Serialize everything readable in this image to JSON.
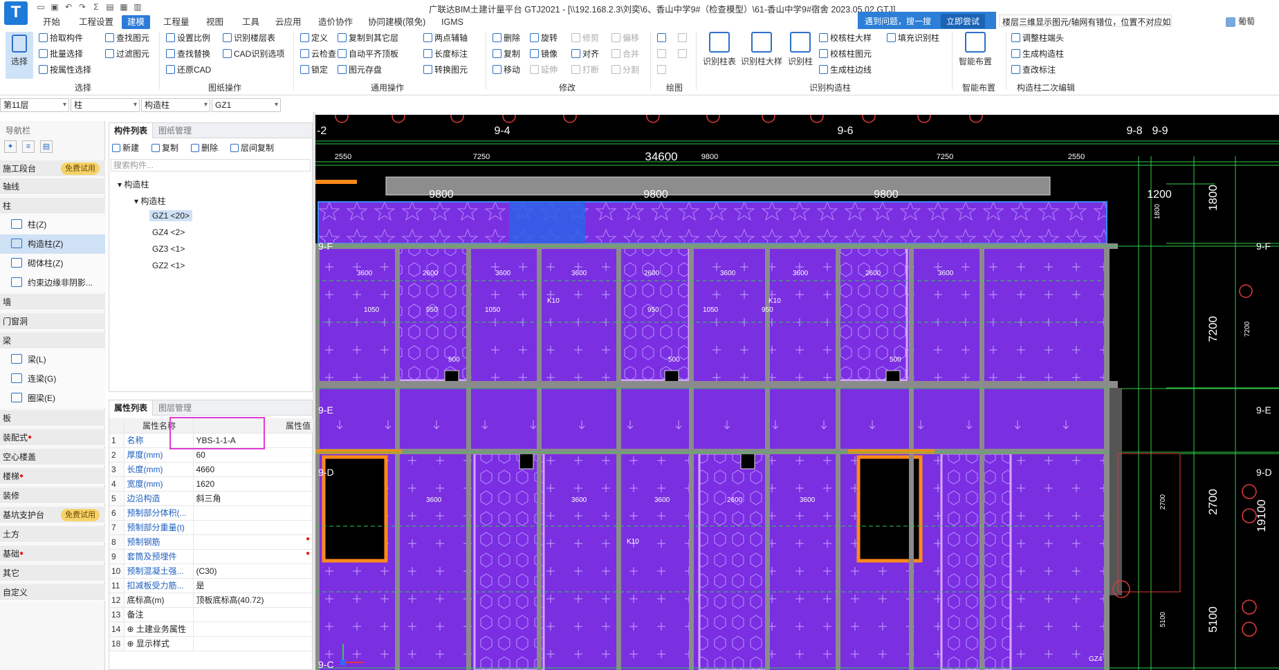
{
  "title_bar": {
    "window_title": "广联达BIM土建计量平台 GTJ2021 - [\\\\192.168.2.3\\刘奕\\6、香山中学9#（检查模型）\\61-香山中学9#宿舍  2023.05.02.GTJ]"
  },
  "menu": {
    "tabs": [
      "开始",
      "工程设置",
      "建模",
      "工程量",
      "视图",
      "工具",
      "云应用",
      "造价协作",
      "协同建模(限免)",
      "IGMS"
    ],
    "active": "建模"
  },
  "help": {
    "popup_text": "遇到问题，搜一搜",
    "popup_button": "立即尝试",
    "search_text": "楼层三维显示图元/轴网有错位，位置不对应如何处理？",
    "user_name": "葡萄"
  },
  "ribbon": {
    "select_label": "选择",
    "select_group": {
      "items": [
        "拾取构件",
        "批量选择",
        "按属性选择",
        "查找图元",
        "过滤图元"
      ],
      "label": "选择"
    },
    "drawing_group": {
      "items": [
        "设置比例",
        "查找替换",
        "还原CAD",
        "识别楼层表",
        "CAD识别选项"
      ],
      "label": "图纸操作"
    },
    "common_group": {
      "items": [
        "定义",
        "云检查",
        "锁定",
        "复制到其它层",
        "自动平齐顶板",
        "图元存盘",
        "两点辅轴",
        "长度标注",
        "转换图元"
      ],
      "label": "通用操作"
    },
    "modify_group": {
      "items": [
        "删除",
        "复制",
        "移动",
        "旋转",
        "镜像",
        "延伸",
        "修剪",
        "对齐",
        "打断",
        "偏移",
        "合并",
        "分割"
      ],
      "label": "修改"
    },
    "draw_group": {
      "label": "绘图"
    },
    "recog_group": {
      "big": [
        "识别柱表",
        "识别柱大样",
        "识别柱"
      ],
      "items": [
        "校核柱大样",
        "校核柱图元",
        "生成柱边线",
        "填充识别柱"
      ],
      "label": "识别构造柱"
    },
    "smart_group": {
      "big": "智能布置",
      "label": "智能布置"
    },
    "edit2_group": {
      "items": [
        "调整柱端头",
        "生成构造柱",
        "查改标注"
      ],
      "label": "构造柱二次编辑"
    }
  },
  "selectors": {
    "floor": "第11层",
    "type": "柱",
    "subtype": "构造柱",
    "name": "GZ1"
  },
  "nav": {
    "title": "导航栏",
    "free_trial": "免费试用",
    "categories": [
      {
        "label": "施工段台",
        "badge": true
      },
      {
        "label": "轴线"
      },
      {
        "label": "柱"
      },
      {
        "label": "墙"
      },
      {
        "label": "门窗洞"
      },
      {
        "label": "梁"
      },
      {
        "label": "板"
      },
      {
        "label": "装配式",
        "dot": true
      },
      {
        "label": "空心楼盖"
      },
      {
        "label": "楼梯",
        "dot": true
      },
      {
        "label": "装修"
      },
      {
        "label": "基坑支护台",
        "badge": true
      },
      {
        "label": "土方"
      },
      {
        "label": "基础",
        "dot": true
      },
      {
        "label": "其它"
      },
      {
        "label": "自定义"
      }
    ],
    "column_items": [
      "柱(Z)",
      "构造柱(Z)",
      "砌体柱(Z)",
      "约束边缘非阴影..."
    ],
    "beam_items": [
      "梁(L)",
      "连梁(G)",
      "圈梁(E)"
    ]
  },
  "component_list": {
    "tabs": [
      "构件列表",
      "图纸管理"
    ],
    "tools": [
      "新建",
      "复制",
      "删除",
      "层间复制"
    ],
    "search_placeholder": "搜索构件...",
    "tree_root": "构造柱",
    "tree_child": "构造柱",
    "items": [
      "GZ1 <20>",
      "GZ4 <2>",
      "GZ3 <1>",
      "GZ2 <1>"
    ]
  },
  "properties": {
    "tabs": [
      "属性列表",
      "图层管理"
    ],
    "header_name": "属性名称",
    "header_value": "属性值",
    "rows": [
      {
        "no": "1",
        "name": "名称",
        "value": "YBS-1-1-A"
      },
      {
        "no": "2",
        "name": "厚度(mm)",
        "value": "60"
      },
      {
        "no": "3",
        "name": "长度(mm)",
        "value": "4660"
      },
      {
        "no": "4",
        "name": "宽度(mm)",
        "value": "1620"
      },
      {
        "no": "5",
        "name": "边沿构造",
        "value": "斜三角"
      },
      {
        "no": "6",
        "name": "预制部分体积(...",
        "value": ""
      },
      {
        "no": "7",
        "name": "预制部分重量(t)",
        "value": ""
      },
      {
        "no": "8",
        "name": "预制钢筋",
        "value": "",
        "dot": true
      },
      {
        "no": "9",
        "name": "套筒及预埋件",
        "value": "",
        "dot": true
      },
      {
        "no": "10",
        "name": "预制混凝土强...",
        "value": "(C30)"
      },
      {
        "no": "11",
        "name": "扣减板受力筋...",
        "value": "是"
      },
      {
        "no": "12",
        "name": "底标高(m)",
        "value": "顶板底标高(40.72)",
        "plain": true
      },
      {
        "no": "13",
        "name": "备注",
        "value": "",
        "plain": true
      },
      {
        "no": "14",
        "name": "⊕ 土建业务属性",
        "value": "",
        "plain": true
      },
      {
        "no": "18",
        "name": "⊕ 显示样式",
        "value": "",
        "plain": true
      }
    ]
  },
  "canvas": {
    "grid_labels": {
      "a": "9-4",
      "b": "9-6",
      "c": "9-8",
      "d": "9-9",
      "left_top": "-2"
    },
    "row_labels": [
      "9-F",
      "9-E",
      "9-D",
      "9-C"
    ],
    "top_dims": [
      "2550",
      "7250",
      "9800",
      "7250",
      "2550"
    ],
    "total_dim": "34600",
    "span_dims": [
      "9800",
      "9800",
      "9800"
    ],
    "right_small_dim": "1200",
    "right_dims": [
      "1800",
      "7200",
      "2700",
      "5100",
      "19100"
    ],
    "right_dim_small": [
      "1800",
      "7200",
      "2700",
      "5100"
    ],
    "room_dims": [
      "3600",
      "2600",
      "3600",
      "3600",
      "2600",
      "3600",
      "3600",
      "2600",
      "3600"
    ],
    "lower_room_dims": [
      "3600",
      "3600",
      "3600",
      "2600",
      "3600"
    ],
    "small_dims": [
      "1050",
      "950",
      "1050",
      "950",
      "1050",
      "950",
      "500",
      "500",
      "500"
    ],
    "labels": [
      "K10",
      "K10",
      "K10",
      "GZ4"
    ]
  }
}
